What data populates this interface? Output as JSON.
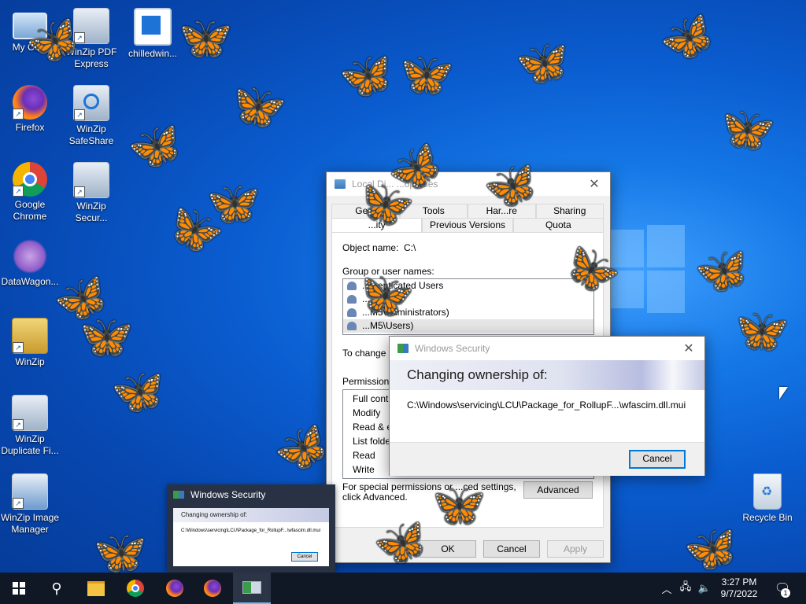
{
  "desktop": {
    "icons": [
      {
        "label": "My Co..."
      },
      {
        "label": "WinZip PDF Express"
      },
      {
        "label": "chilledwin..."
      },
      {
        "label": "Firefox"
      },
      {
        "label": "WinZip SafeShare"
      },
      {
        "label": "Google Chrome"
      },
      {
        "label": "WinZip Secur..."
      },
      {
        "label": "DataWagon..."
      },
      {
        "label": "WinZip"
      },
      {
        "label": "WinZip Duplicate Fi..."
      },
      {
        "label": "WinZip Image Manager"
      },
      {
        "label": "Recycle Bin"
      }
    ]
  },
  "properties": {
    "title": "Local Di...  ...operties",
    "tabs_row1": [
      "Ge...",
      "Tools",
      "Har...re",
      "Sharing"
    ],
    "tabs_row2": [
      "...ity",
      "Previous Versions",
      "Quota"
    ],
    "object_name_label": "Object name:",
    "object_name_value": "C:\\",
    "group_label": "Group or user names:",
    "users": [
      "...thenticated Users",
      "...STEM",
      "...M5\\Administrators)",
      "...M5\\Users)"
    ],
    "change_text": "To change p...",
    "permissions_label": "Permissions f...",
    "permissions": [
      "Full contro...",
      "Modify",
      "Read & ex...",
      "List folder...",
      "Read",
      "Write"
    ],
    "special_text": "For special permissions or ...ced settings,",
    "special_text2": "click Advanced.",
    "advanced_label": "Advanced",
    "ok_label": "OK",
    "cancel_label": "Cancel",
    "apply_label": "Apply"
  },
  "security_dialog": {
    "title": "Windows Security",
    "header": "Changing ownership of:",
    "path": "C:\\Windows\\servicing\\LCU\\Package_for_RollupF...\\wfascim.dll.mui",
    "cancel_label": "Cancel"
  },
  "thumbnail": {
    "title": "Windows Security",
    "header": "Changing ownership of:",
    "path": "C:\\Windows\\servicing\\LCU\\Package_for_RollupF...\\wfascim.dll.mui",
    "cancel_label": "Cancel"
  },
  "taskbar": {
    "time": "3:27 PM",
    "date": "9/7/2022",
    "notification_count": "1"
  }
}
